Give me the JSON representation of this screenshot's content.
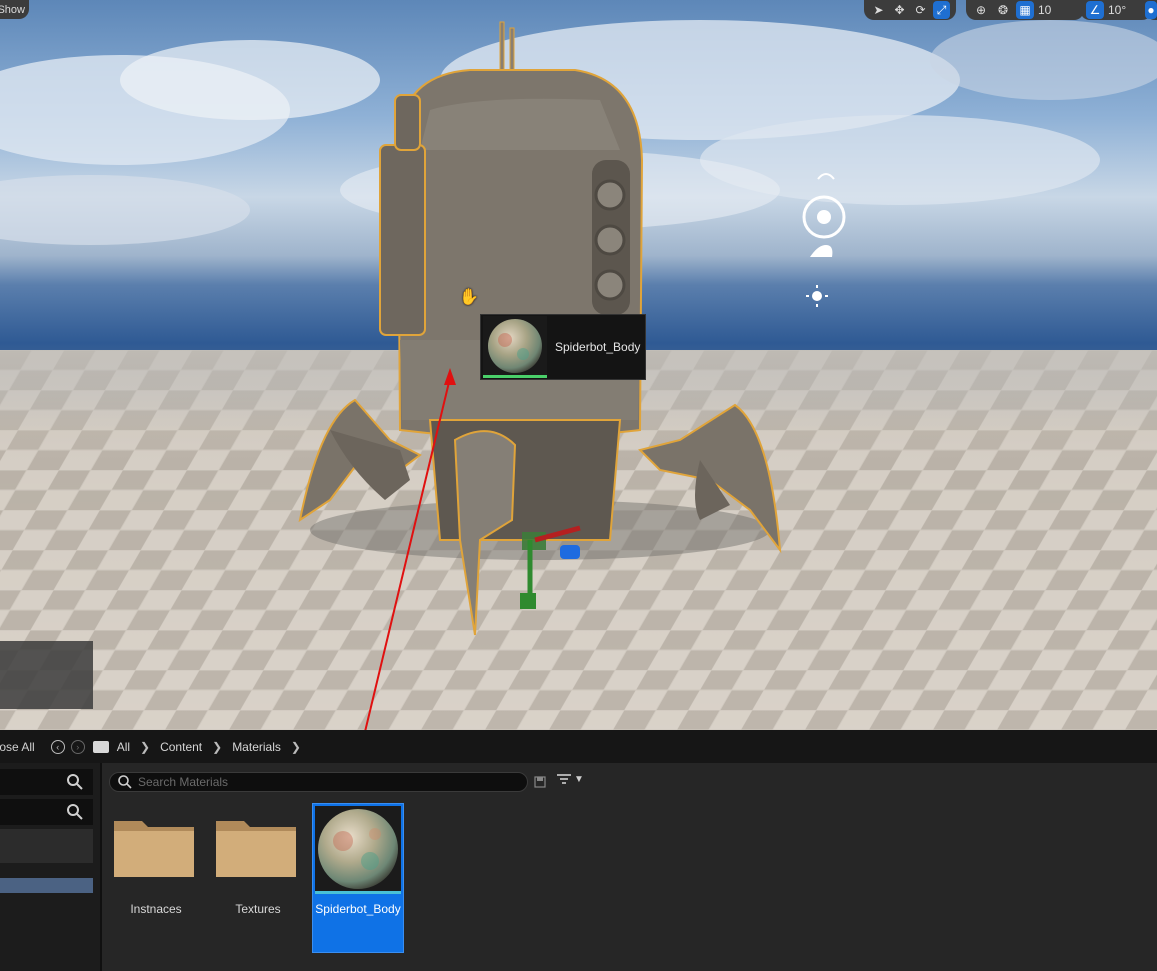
{
  "viewport": {
    "show_label": "Show",
    "snap_grid_value": "10",
    "rotation_snap_value": "10°",
    "drag_tooltip": {
      "asset_name": "Spiderbot_Body"
    }
  },
  "content_browser": {
    "collapse_all_label": "Close All",
    "breadcrumbs": [
      "All",
      "Content",
      "Materials"
    ],
    "search_placeholder": "Search Materials",
    "assets": [
      {
        "name": "Instnaces",
        "type": "folder"
      },
      {
        "name": "Textures",
        "type": "folder"
      },
      {
        "name": "Spiderbot_Body",
        "type": "material",
        "selected": true
      }
    ]
  },
  "colors": {
    "selection_blue": "#0f72e6",
    "outline_orange": "#e0a43a",
    "drag_arrow_red": "#e01010"
  }
}
